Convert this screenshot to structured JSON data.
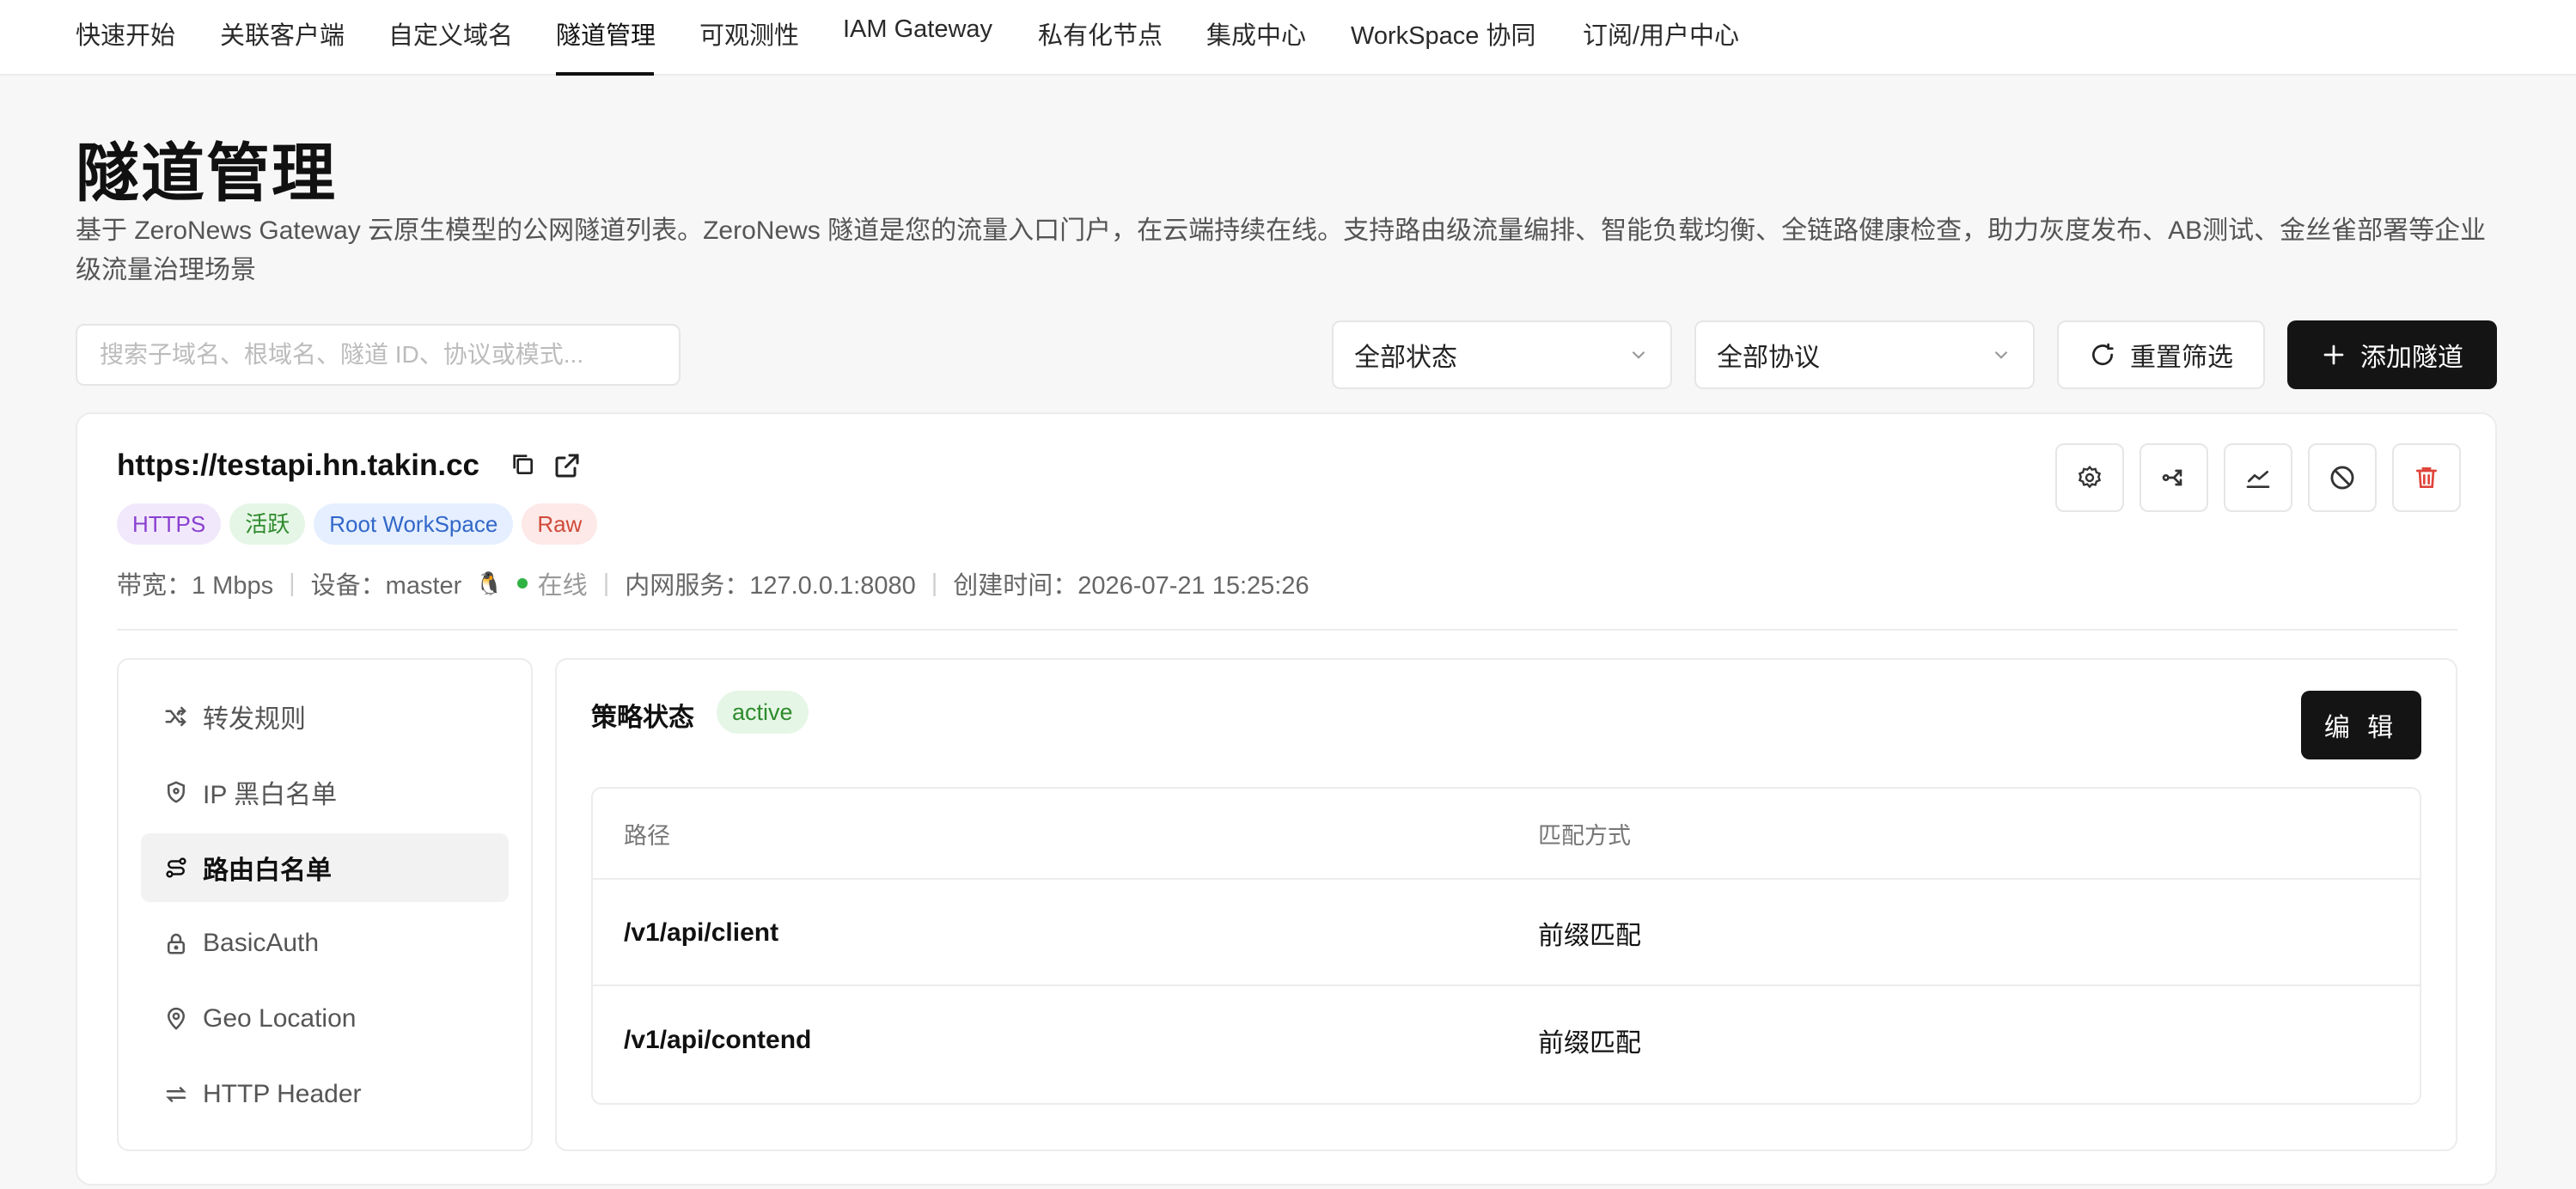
{
  "nav": {
    "items": [
      {
        "label": "快速开始"
      },
      {
        "label": "关联客户端"
      },
      {
        "label": "自定义域名"
      },
      {
        "label": "隧道管理"
      },
      {
        "label": "可观测性"
      },
      {
        "label": "IAM Gateway"
      },
      {
        "label": "私有化节点"
      },
      {
        "label": "集成中心"
      },
      {
        "label": "WorkSpace 协同"
      },
      {
        "label": "订阅/用户中心"
      }
    ],
    "active_index": 3
  },
  "page": {
    "title": "隧道管理",
    "description": "基于 ZeroNews Gateway 云原生模型的公网隧道列表。ZeroNews 隧道是您的流量入口门户，在云端持续在线。支持路由级流量编排、智能负载均衡、全链路健康检查，助力灰度发布、AB测试、金丝雀部署等企业级流量治理场景"
  },
  "toolbar": {
    "search_placeholder": "搜索子域名、根域名、隧道 ID、协议或模式...",
    "status_select": "全部状态",
    "protocol_select": "全部协议",
    "reset_label": "重置筛选",
    "add_label": "添加隧道"
  },
  "tunnel": {
    "url": "https://testapi.hn.takin.cc",
    "tags": {
      "protocol": "HTTPS",
      "state": "活跃",
      "workspace": "Root WorkSpace",
      "mode": "Raw"
    },
    "meta": {
      "bandwidth": "带宽：1 Mbps",
      "device": "设备：master",
      "online": "在线",
      "service": "内网服务：127.0.0.1:8080",
      "created": "创建时间：2026-07-21 15:25:26"
    },
    "sidebar": [
      {
        "label": "转发规则",
        "icon": "shuffle-icon"
      },
      {
        "label": "IP 黑白名单",
        "icon": "shield-icon"
      },
      {
        "label": "路由白名单",
        "icon": "route-icon"
      },
      {
        "label": "BasicAuth",
        "icon": "lock-icon"
      },
      {
        "label": "Geo Location",
        "icon": "map-pin-icon"
      },
      {
        "label": "HTTP Header",
        "icon": "arrows-swap-icon"
      }
    ],
    "selected_sidebar_index": 2,
    "policy": {
      "title": "策略状态",
      "status": "active",
      "edit_label": "编 辑",
      "columns": {
        "path": "路径",
        "match": "匹配方式"
      },
      "rows": [
        {
          "path": "/v1/api/client",
          "match": "前缀匹配"
        },
        {
          "path": "/v1/api/contend",
          "match": "前缀匹配"
        }
      ]
    }
  }
}
